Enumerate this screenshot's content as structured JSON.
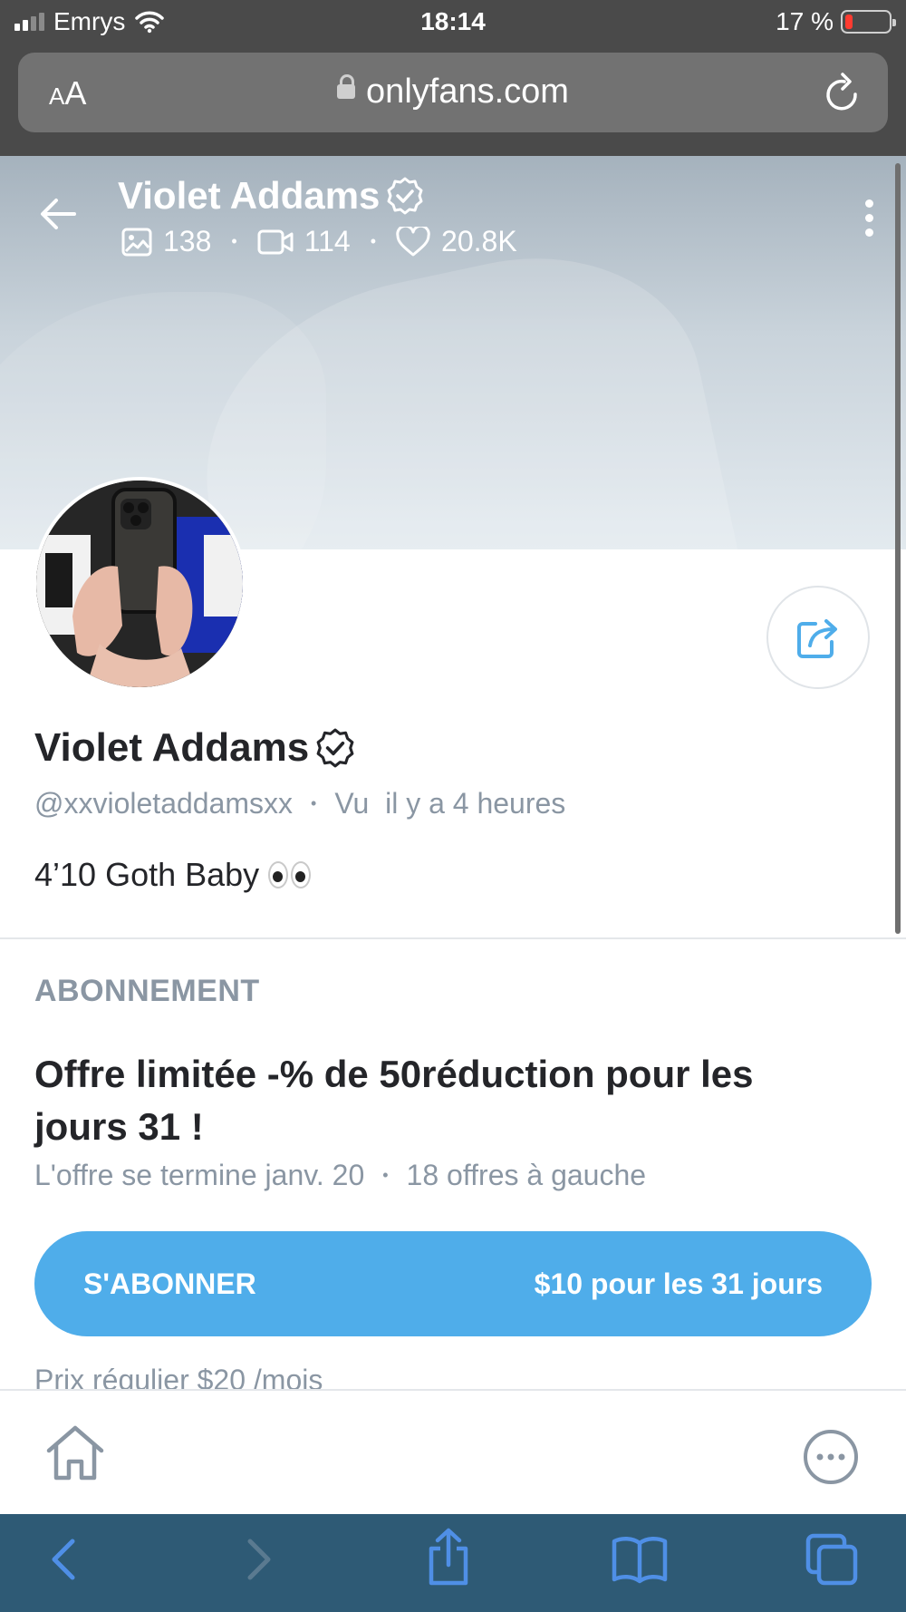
{
  "status_bar": {
    "carrier": "Emrys",
    "time": "18:14",
    "battery": "17 %"
  },
  "browser": {
    "aa_small": "A",
    "aa_large": "A",
    "url": "onlyfans.com"
  },
  "cover": {
    "name": "Violet Addams",
    "photos_count": "138",
    "videos_count": "114",
    "likes_count": "20.8K"
  },
  "profile": {
    "name": "Violet Addams",
    "handle": "@xxvioletaddamsxx",
    "last_seen": "Vu  il y a 4 heures",
    "bio": "4’10 Goth Baby"
  },
  "subscription": {
    "heading": "ABONNEMENT",
    "offer_title": "Offre limitée -% de 50réduction pour les jours 31 !",
    "offer_end": "L'offre se termine janv. 20",
    "offers_left": "18 offres à gauche",
    "button_label": "S'ABONNER",
    "button_price": "$10 pour les 31 jours",
    "regular_price": "Prix régulier $20 /mois"
  },
  "colors": {
    "accent": "#4fadea",
    "muted": "#8a96a3",
    "safari_toolbar": "#2e5a75"
  }
}
